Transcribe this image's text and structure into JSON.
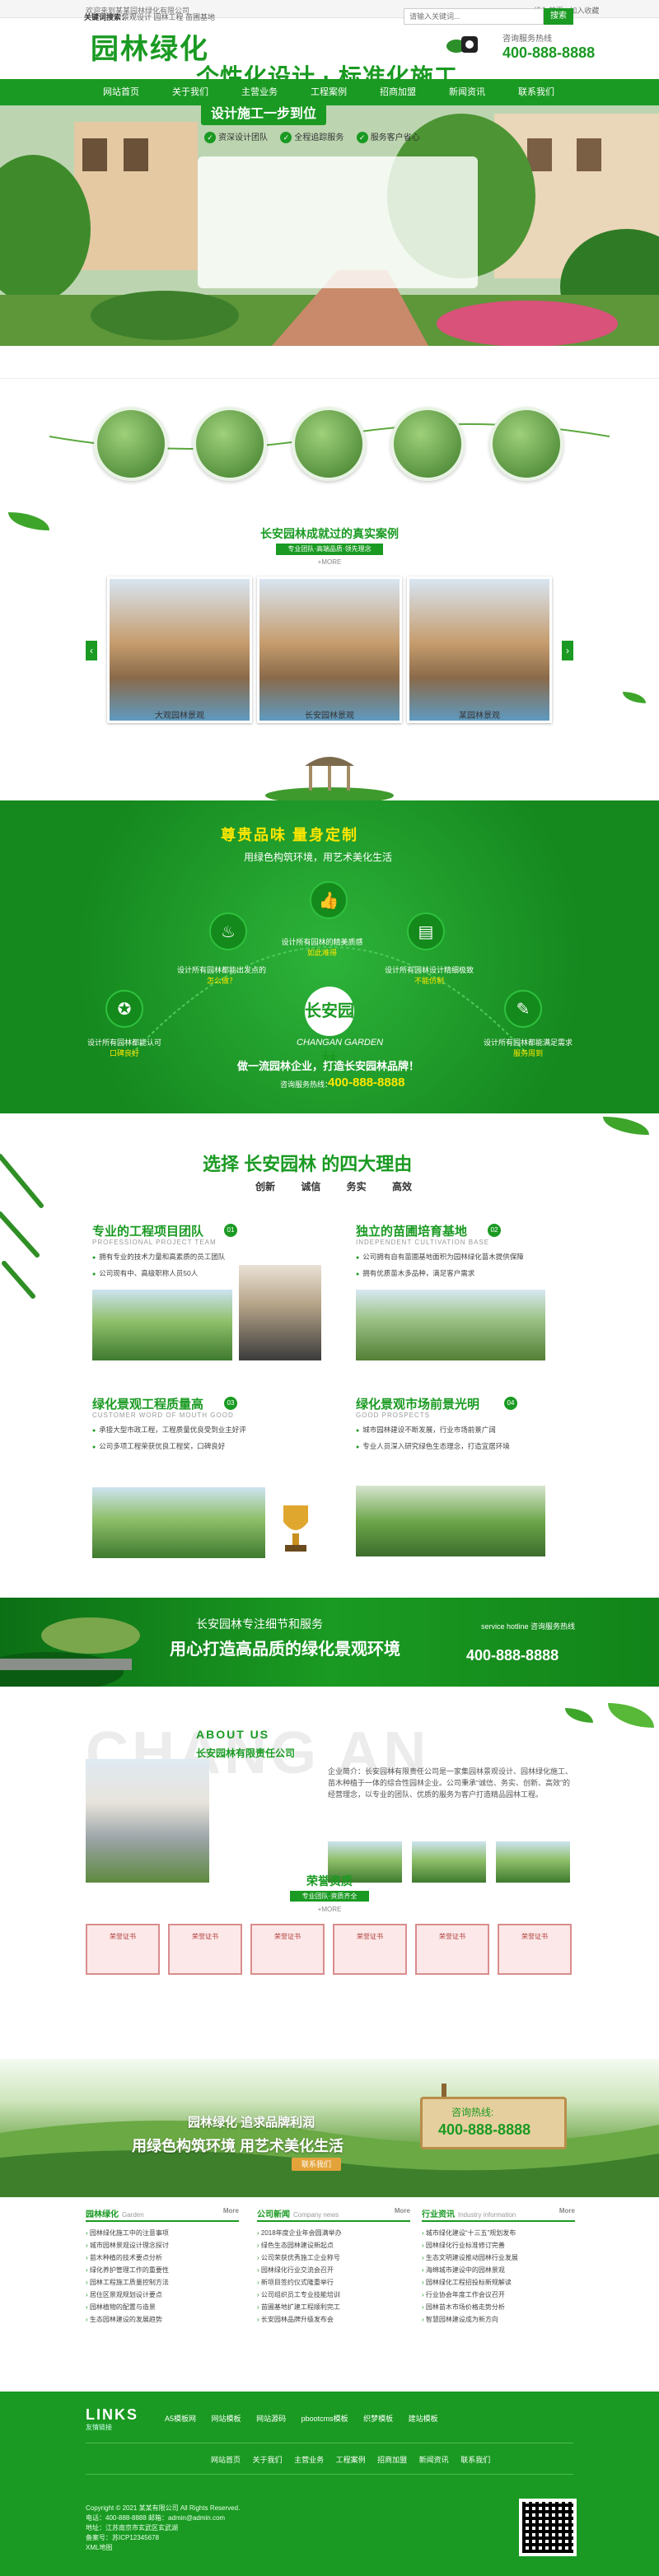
{
  "topbar": {
    "left": "欢迎来到某某园林绿化有限公司",
    "right": "设为首页  |  加入收藏"
  },
  "header": {
    "logo": "园林绿化",
    "hotline_label": "咨询服务热线",
    "hotline_number": "400-888-8888"
  },
  "nav": [
    "网站首页",
    "关于我们",
    "主营业务",
    "工程案例",
    "招商加盟",
    "新闻资讯",
    "联系我们"
  ],
  "banner": {
    "headline": "个性化设计 · 标准化施工",
    "subline": "设计施工一步到位",
    "tags": [
      "资深设计团队",
      "全程追踪服务",
      "服务客户省心"
    ]
  },
  "search": {
    "hotkw_label": "关键词搜索：",
    "hotkw": "景观设计  园林工程  苗圃基地",
    "placeholder": "请输入关键词...",
    "button": "搜索"
  },
  "cases": {
    "title": "长安园林成就过的真实案例",
    "subtitle": "专业团队·高端品质·领先理念",
    "more": "+MORE",
    "items": [
      "大观园林景观",
      "长安园林景观",
      "某园林景观"
    ]
  },
  "value": {
    "title": "尊贵品味  量身定制",
    "subtitle": "用绿色构筑环境，用艺术美化生活",
    "points": [
      {
        "text": "设计所有园林的精美质感",
        "em": "如此难得"
      },
      {
        "text": "设计所有园林都能出发点的",
        "em": "怎么做？"
      },
      {
        "text": "设计所有园林也精心设计",
        "em": "难以超越"
      },
      {
        "text": "设计所有园林设计精细极致",
        "em": "不能仿制"
      },
      {
        "text": "设计所有园林都能认可",
        "em": "口碑良好"
      },
      {
        "text": "设计所有园林都能满足需求",
        "em": "服务周到"
      }
    ],
    "brand": "长安园林",
    "brand_en": "CHANGAN GARDEN",
    "slogan": "做一流园林企业，打造长安园林品牌！",
    "hotline_label": "咨询服务热线：",
    "hotline_number": "400-888-8888"
  },
  "reasons": {
    "title": "选择 长安园林 的四大理由",
    "tabs": [
      "创新",
      "诚信",
      "务实",
      "高效"
    ],
    "items": [
      {
        "title": "专业的工程项目团队",
        "en": "PROFESSIONAL PROJECT TEAM",
        "num": "01",
        "points": [
          "拥有专业的技术力量和高素质的员工团队",
          "公司现有中、高级职称人员50人"
        ]
      },
      {
        "title": "独立的苗圃培育基地",
        "en": "INDEPENDENT CULTIVATION BASE",
        "num": "02",
        "points": [
          "公司拥有自有苗圃基地面积为园林绿化苗木提供保障",
          "拥有优质苗木多品种，满足客户需求"
        ]
      },
      {
        "title": "绿化景观工程质量高",
        "en": "CUSTOMER WORD OF MOUTH GOOD",
        "num": "03",
        "points": [
          "承接大型市政工程，工程质量优良受到业主好评",
          "公司多项工程荣获优良工程奖，口碑良好"
        ]
      },
      {
        "title": "绿化景观市场前景光明",
        "en": "GOOD PROSPECTS",
        "num": "04",
        "points": [
          "城市园林建设不断发展，行业市场前景广阔",
          "专业人员深入研究绿色生态理念，打造宜居环境"
        ]
      }
    ]
  },
  "band2": {
    "line1": "长安园林专注细节和服务",
    "line2": "用心打造高品质的绿化景观环境",
    "label": "service hotline 咨询服务热线",
    "number": "400-888-8888"
  },
  "about": {
    "bg": "CHANG AN",
    "en": "ABOUT US",
    "name": "长安园林有限责任公司",
    "text": "企业简介：长安园林有限责任公司是一家集园林景观设计、园林绿化施工、苗木种植于一体的综合性园林企业。公司秉承“诚信、务实、创新、高效”的经营理念，以专业的团队、优质的服务为客户打造精品园林工程。"
  },
  "honors": {
    "title": "荣誉资质",
    "subtitle": "专业团队·资质齐全",
    "more": "+MORE",
    "count": 6
  },
  "hill": {
    "line1": "园林绿化 追求品牌利润",
    "line2": "用绿色构筑环境 用艺术美化生活",
    "sign_label": "咨询热线:",
    "sign_number": "400-888-8888",
    "contact_button": "联系我们"
  },
  "news": [
    {
      "title": "园林绿化",
      "en": "Garden",
      "more": "More",
      "items": [
        "园林绿化施工中的注意事项",
        "城市园林景观设计理念探讨",
        "苗木种植的技术要点分析",
        "绿化养护管理工作的重要性",
        "园林工程施工质量控制方法",
        "居住区景观规划设计要点",
        "园林植物的配置与造景",
        "生态园林建设的发展趋势"
      ]
    },
    {
      "title": "公司新闻",
      "en": "Company news",
      "more": "More",
      "items": [
        "2018年度企业年会圆满举办",
        "绿色生态园林建设新起点",
        "公司荣获优秀施工企业称号",
        "园林绿化行业交流会召开",
        "新项目签约仪式隆重举行",
        "公司组织员工专业技能培训",
        "苗圃基地扩建工程顺利完工",
        "长安园林品牌升级发布会"
      ]
    },
    {
      "title": "行业资讯",
      "en": "Industry information",
      "more": "More",
      "items": [
        "城市绿化建设“十三五”规划发布",
        "园林绿化行业标准修订完善",
        "生态文明建设推动园林行业发展",
        "海绵城市建设中的园林景观",
        "园林绿化工程招投标新规解读",
        "行业协会年度工作会议召开",
        "园林苗木市场价格走势分析",
        "智慧园林建设成为新方向"
      ]
    }
  ],
  "footer": {
    "links_label": "LINKS",
    "links_sub": "友情链接",
    "links": [
      "A5模板网",
      "网站模板",
      "网站源码",
      "pbootcms模板",
      "织梦模板",
      "建站模板"
    ],
    "nav": [
      "网站首页",
      "关于我们",
      "主营业务",
      "工程案例",
      "招商加盟",
      "新闻资讯",
      "联系我们"
    ],
    "info": [
      "Copyright © 2021 某某有限公司 All Rights Reserved.",
      "电话：400-888-8888  邮箱：admin@admin.com",
      "地址：江苏南京市玄武区玄武湖",
      "备案号：苏ICP12345678",
      "XML地图"
    ]
  }
}
